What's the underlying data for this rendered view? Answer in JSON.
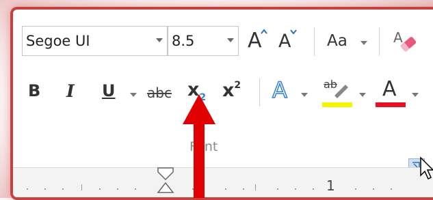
{
  "ribbon": {
    "font_name": "Segoe UI",
    "font_size": "8.5",
    "grow_font_label": "A",
    "shrink_font_label": "A",
    "change_case_label": "Aa",
    "bold_label": "B",
    "italic_label": "I",
    "underline_label": "U",
    "strikethrough_label": "abc",
    "subscript_base": "x",
    "subscript_index": "2",
    "superscript_base": "x",
    "superscript_index": "2",
    "text_effects_label": "A",
    "highlight_label": "ab",
    "font_color_label": "A",
    "group_name": "Font"
  },
  "ruler": {
    "marker": "1"
  },
  "colors": {
    "accent_red": "#e00000",
    "panel_border": "#c9413f",
    "highlight_yellow": "#f5f500",
    "font_color_red": "#e81123",
    "text_effects_blue": "#2f7fd3",
    "eraser_pink": "#e8587a"
  },
  "icons": {
    "clear_formatting": "eraser-icon",
    "dialog_launcher": "dialog-launcher-icon",
    "pointer": "mouse-pointer-icon",
    "annotation_arrow": "red-up-arrow"
  }
}
